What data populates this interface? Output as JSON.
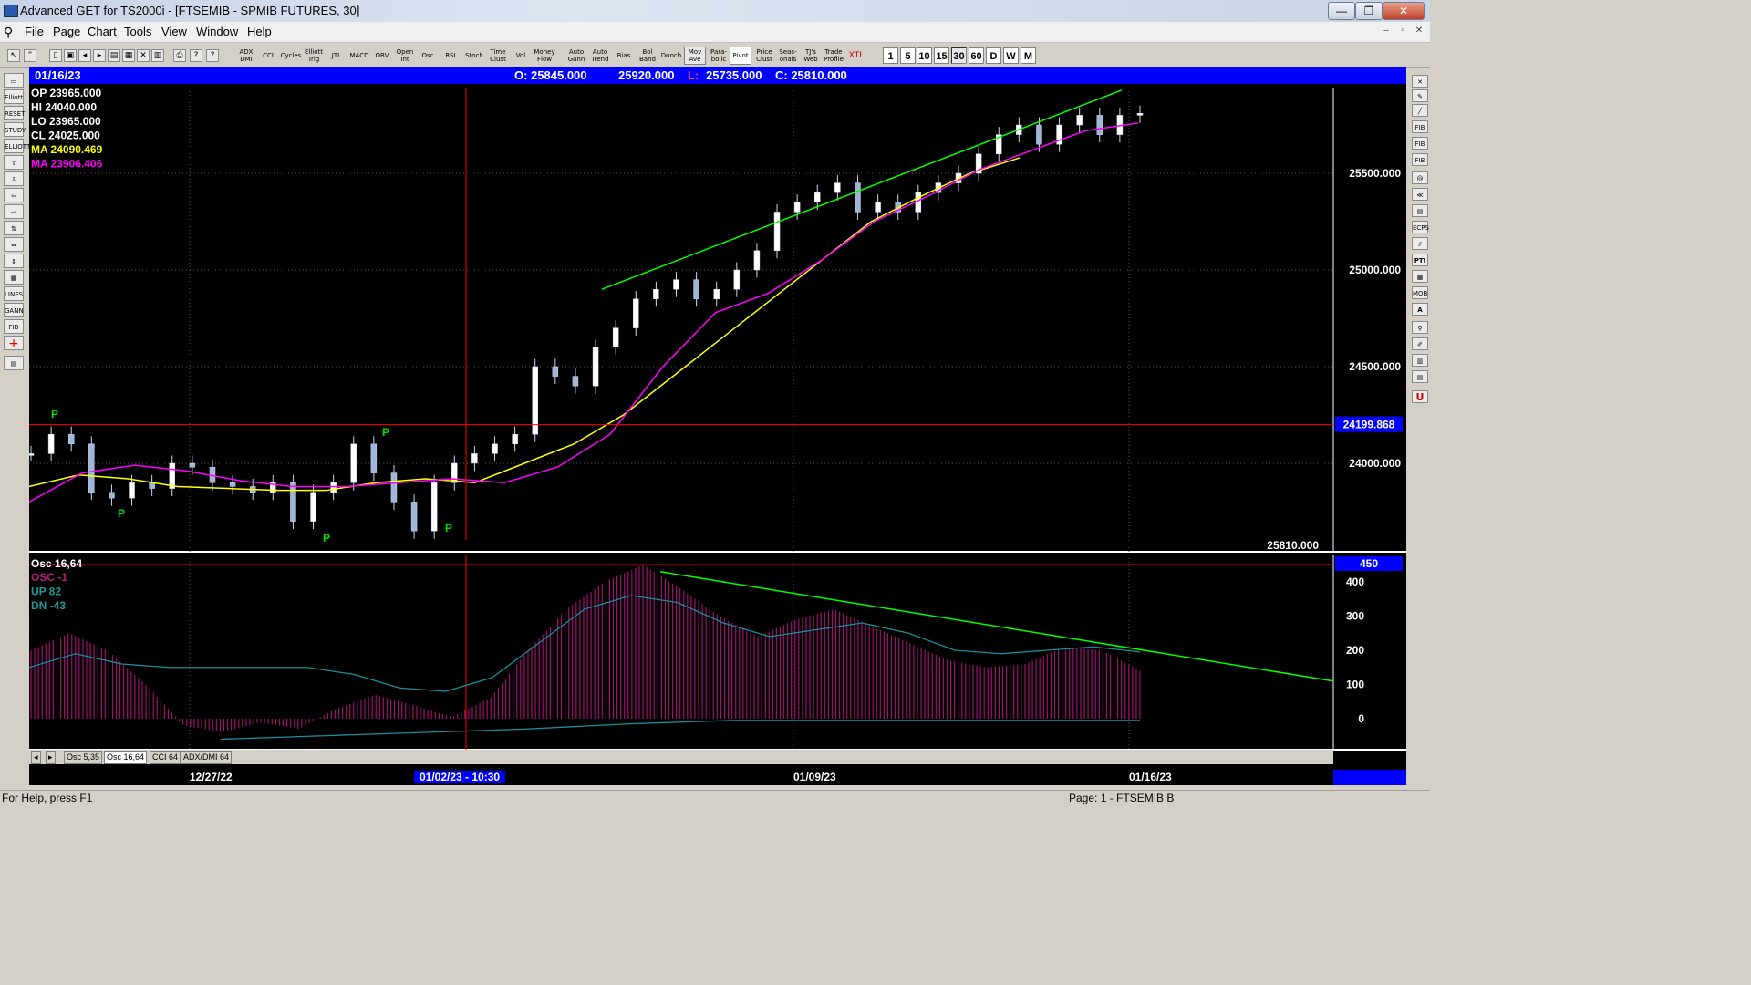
{
  "window": {
    "title": "Advanced GET for TS2000i - [FTSEMIB - SPMIB FUTURES, 30]",
    "minimize": "—",
    "maximize": "❐",
    "close": "✕"
  },
  "menu": [
    "File",
    "Page",
    "Chart",
    "Tools",
    "View",
    "Window",
    "Help"
  ],
  "mdi_controls": [
    "–",
    "▫",
    "✕"
  ],
  "toolbar": {
    "indicators": [
      "ADX DMI",
      "CCI",
      "Cycles",
      "Elliott Trig",
      "JTI",
      "MACD",
      "OBV",
      "Open Int",
      "Osc",
      "RSI",
      "Stoch",
      "Time Clust",
      "Vol",
      "Money Flow",
      "Auto Gann",
      "Auto Trend",
      "Bias",
      "Bol Band",
      "Donch",
      "Mov Ave",
      "Para-bolic",
      "Pivot",
      "Price Clust",
      "Seas-onals",
      "TJ's Web",
      "Trade Profile",
      "XTL"
    ],
    "timeframes": [
      "1",
      "5",
      "10",
      "15",
      "30",
      "60",
      "D",
      "W",
      "M"
    ],
    "selected_timeframe": "30"
  },
  "left_tools": [
    "Elliott",
    "RESET",
    "STUDY",
    "ELLIOTT",
    "LINES",
    "GANN",
    "FIB"
  ],
  "right_tools": [
    "FIB RET",
    "FIB EXT",
    "FIB TIME",
    "ECPS",
    "PTI",
    "MOB",
    "A",
    "U"
  ],
  "info": {
    "date": "01/16/23",
    "open": "O: 25845.000",
    "high": "25920.000",
    "low_label": "L:",
    "low": "25735.000",
    "close": "C: 25810.000"
  },
  "price_panel": {
    "readouts": [
      {
        "label": "OP",
        "value": "23965.000",
        "color": "#ffffff"
      },
      {
        "label": "HI",
        "value": "24040.000",
        "color": "#ffffff"
      },
      {
        "label": "LO",
        "value": "23965.000",
        "color": "#ffffff"
      },
      {
        "label": "CL",
        "value": "24025.000",
        "color": "#ffffff"
      },
      {
        "label": "MA",
        "value": "24090.469",
        "color": "#ffff00"
      },
      {
        "label": "MA",
        "value": "23906.406",
        "color": "#ff00ff"
      }
    ],
    "axis_labels": [
      "25500.000",
      "25000.000",
      "24500.000",
      "24000.000"
    ],
    "crosshair_price": "24199.868",
    "last_price": "25810.000",
    "pivot_marker": "P"
  },
  "osc_panel": {
    "title": "Osc 16,64",
    "readouts": [
      {
        "label": "OSC",
        "value": "-1",
        "color": "#b0207a"
      },
      {
        "label": "UP",
        "value": "82",
        "color": "#1a9a9a"
      },
      {
        "label": "DN",
        "value": "-43",
        "color": "#1a9a9a"
      }
    ],
    "axis_labels": [
      "400",
      "300",
      "200",
      "100",
      "0"
    ],
    "crosshair_value": "450"
  },
  "tabs": [
    "Osc 5,35",
    "Osc 16,64",
    "CCI 64",
    "ADX/DMI 64"
  ],
  "selected_tab": "Osc 16,64",
  "time_axis": {
    "labels": [
      "12/27/22",
      "01/09/23",
      "01/16/23"
    ],
    "cursor": "01/02/23 - 10:30"
  },
  "status": {
    "help": "For Help, press F1",
    "page": "Page: 1 - FTSEMIB B"
  },
  "chart_data": {
    "type": "candlestick",
    "symbol": "FTSEMIB - SPMIB FUTURES",
    "interval": "30",
    "price_ticks": [
      24000,
      24500,
      25000,
      25500
    ],
    "osc_ticks": [
      0,
      100,
      200,
      300,
      400
    ],
    "close_series": [
      24050,
      24150,
      24100,
      23850,
      23820,
      23900,
      23870,
      24000,
      23980,
      23900,
      23880,
      23850,
      23900,
      23700,
      23850,
      23900,
      24100,
      23950,
      23800,
      23650,
      23900,
      24000,
      24050,
      24100,
      24150,
      24500,
      24450,
      24400,
      24600,
      24700,
      24850,
      24900,
      24950,
      24850,
      24900,
      25000,
      25100,
      25300,
      25350,
      25400,
      25450,
      25300,
      25350,
      25300,
      25400,
      25450,
      25500,
      25600,
      25700,
      25750,
      25650,
      25750,
      25800,
      25700,
      25800,
      25810
    ],
    "ma_yellow": [
      23880,
      23940,
      23920,
      23880,
      23870,
      23860,
      23860,
      23900,
      23920,
      23900,
      24000,
      24100,
      24250,
      24450,
      24650,
      24850,
      25050,
      25250,
      25380,
      25500,
      25580
    ],
    "ma_magenta": [
      23800,
      23950,
      23990,
      23960,
      23910,
      23880,
      23880,
      23900,
      23920,
      23900,
      23980,
      24150,
      24500,
      24780,
      24880,
      25050,
      25250,
      25380,
      25520,
      25620,
      25720,
      25760
    ],
    "osc_histogram": [
      200,
      250,
      200,
      100,
      -20,
      -40,
      -10,
      -30,
      30,
      70,
      40,
      5,
      60,
      200,
      320,
      400,
      450,
      380,
      300,
      240,
      290,
      320,
      270,
      220,
      170,
      150,
      160,
      210,
      200,
      140
    ],
    "osc_up_line": [
      150,
      190,
      160,
      150,
      150,
      150,
      150,
      130,
      90,
      80,
      120,
      220,
      320,
      360,
      340,
      280,
      240,
      260,
      280,
      250,
      200,
      190,
      200,
      210,
      195
    ],
    "osc_dn_line": [
      -60,
      -50,
      -40,
      -30,
      -15,
      -5,
      -5,
      -5,
      -5,
      -5
    ],
    "pivot_labels": [
      "P",
      "P",
      "P",
      "P",
      "P"
    ]
  },
  "colors": {
    "infobar": "#0000ff",
    "ma_fast": "#ffff00",
    "ma_slow": "#ff00ff",
    "trendline": "#00ff00",
    "crosshair": "#ff0000",
    "osc_bars": "#a01070",
    "osc_up": "#1a8f9a"
  }
}
